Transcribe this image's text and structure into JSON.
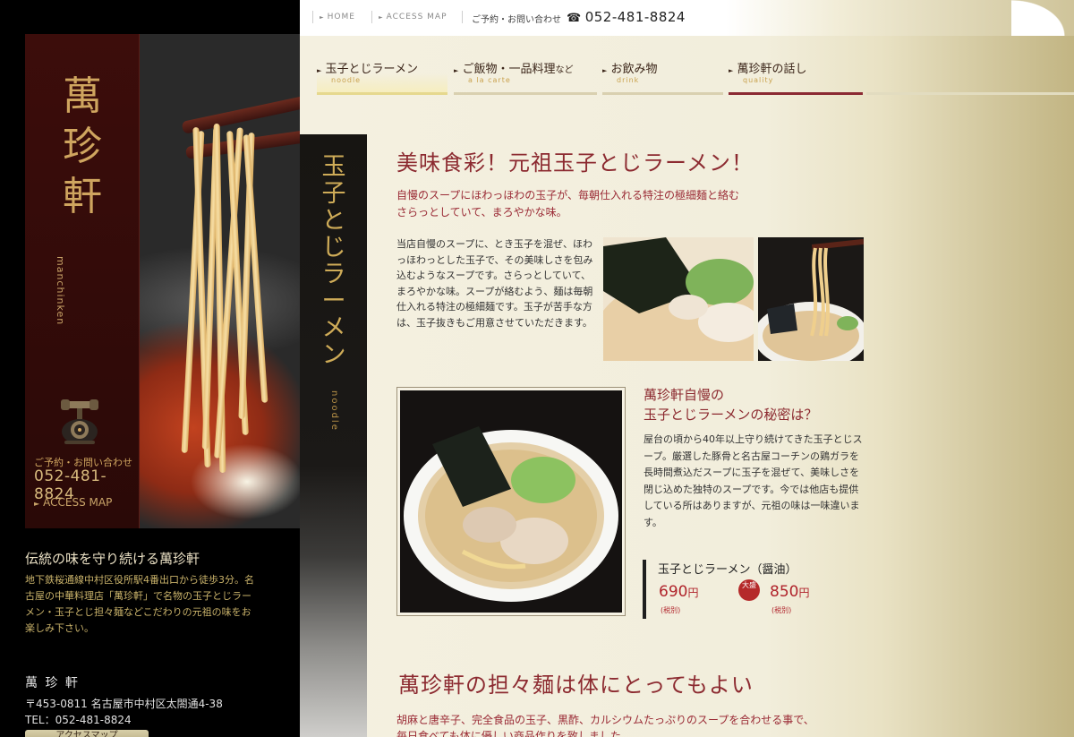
{
  "topbar": {
    "home": "HOME",
    "access": "ACCESS MAP",
    "reservation_label": "ご予約・お問い合わせ",
    "tel": "052-481-8824"
  },
  "nav": [
    {
      "label": "玉子とじラーメン",
      "small": "",
      "sub": "noodle"
    },
    {
      "label": "ご飯物・一品料理",
      "small": "など",
      "sub": "a la carte"
    },
    {
      "label": "お飲み物",
      "small": "",
      "sub": "drink"
    },
    {
      "label": "萬珍軒の話し",
      "small": "",
      "sub": "quality"
    }
  ],
  "sidebar": {
    "brand_kanji": "萬珍軒",
    "brand_romaji": "manchinken",
    "reservation_label": "ご予約・お問い合わせ",
    "tel": "052-481-8824",
    "access": "ACCESS MAP",
    "heading": "伝統の味を守り続ける萬珍軒",
    "description": "地下鉄桜通線中村区役所駅4番出口から徒歩3分。名古屋の中華料理店「萬珍軒」で名物の玉子とじラーメン・玉子とじ担々麺などこだわりの元祖の味をお楽しみ下さい。",
    "shop_name": "萬 珍 軒",
    "address": "〒453-0811 名古屋市中村区太閤通4-38",
    "tel_line": "TEL：052-481-8824",
    "button": "アクセスマップ"
  },
  "banner": {
    "title": "玉子とじラーメン",
    "sub": "noodle"
  },
  "main": {
    "headline": "美味食彩！元祖玉子とじラーメン！",
    "lead_line1": "自慢のスープにほわっほわの玉子が、毎朝仕入れる特注の極細麺と絡む",
    "lead_line2": "さらっとしていて、まろやかな味。",
    "body": "当店自慢のスープに、とき玉子を混ぜ、ほわっほわっとした玉子で、その美味しさを包み込むようなスープです。さらっとしていて、まろやかな味。スープが絡むよう、麺は毎朝仕入れる特注の極細麺です。玉子が苦手な方は、玉子抜きもご用意させていただきます。",
    "secret_title1": "萬珍軒自慢の",
    "secret_title2": "玉子とじラーメンの秘密は？",
    "secret_text": "屋台の頃から40年以上守り続けてきた玉子とじスープ。厳選した豚骨と名古屋コーチンの鶏ガラを長時間煮込だスープに玉子を混ぜて、美味しさを閉じ込めた独特のスープです。今では他店も提供している所はありますが、元祖の味は一味違います。",
    "price_name": "玉子とじラーメン（醤油）",
    "price1": "690",
    "price2": "850",
    "currency": "円",
    "tax": "(税別)",
    "oomori": "大盛",
    "section2_title": "萬珍軒の担々麺は体にとってもよい",
    "section2_line1": "胡麻と唐辛子、完全食品の玉子、黒酢、カルシウムたっぷりのスープを合わせる事で、",
    "section2_line2": "毎日食べても体に優しい商品作りを致しました。"
  },
  "colors": {
    "brand_red": "#8c2a30",
    "gold": "#cfa55f",
    "price_red": "#b0232b"
  }
}
